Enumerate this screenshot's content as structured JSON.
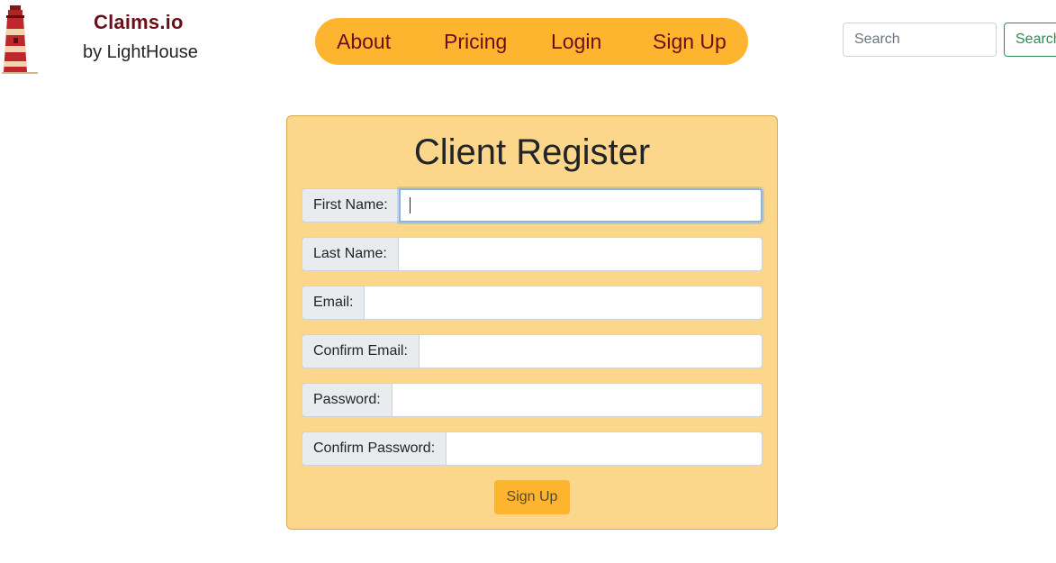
{
  "brand": {
    "title": "Claims.io",
    "subtitle": "by LightHouse",
    "icon": "lighthouse-icon",
    "color": "#6b0f18"
  },
  "nav": {
    "items": [
      {
        "label": "About"
      },
      {
        "label": "Pricing"
      },
      {
        "label": "Login"
      },
      {
        "label": "Sign Up"
      }
    ],
    "pill_color": "#fdb52f"
  },
  "search": {
    "placeholder": "Search",
    "button_label": "Search"
  },
  "form": {
    "title": "Client Register",
    "fields": [
      {
        "label": "First Name:",
        "value": ""
      },
      {
        "label": "Last Name:",
        "value": ""
      },
      {
        "label": "Email:",
        "value": ""
      },
      {
        "label": "Confirm Email:",
        "value": ""
      },
      {
        "label": "Password:",
        "value": ""
      },
      {
        "label": "Confirm Password:",
        "value": ""
      }
    ],
    "submit_label": "Sign Up",
    "card_color": "#fcd68b"
  }
}
